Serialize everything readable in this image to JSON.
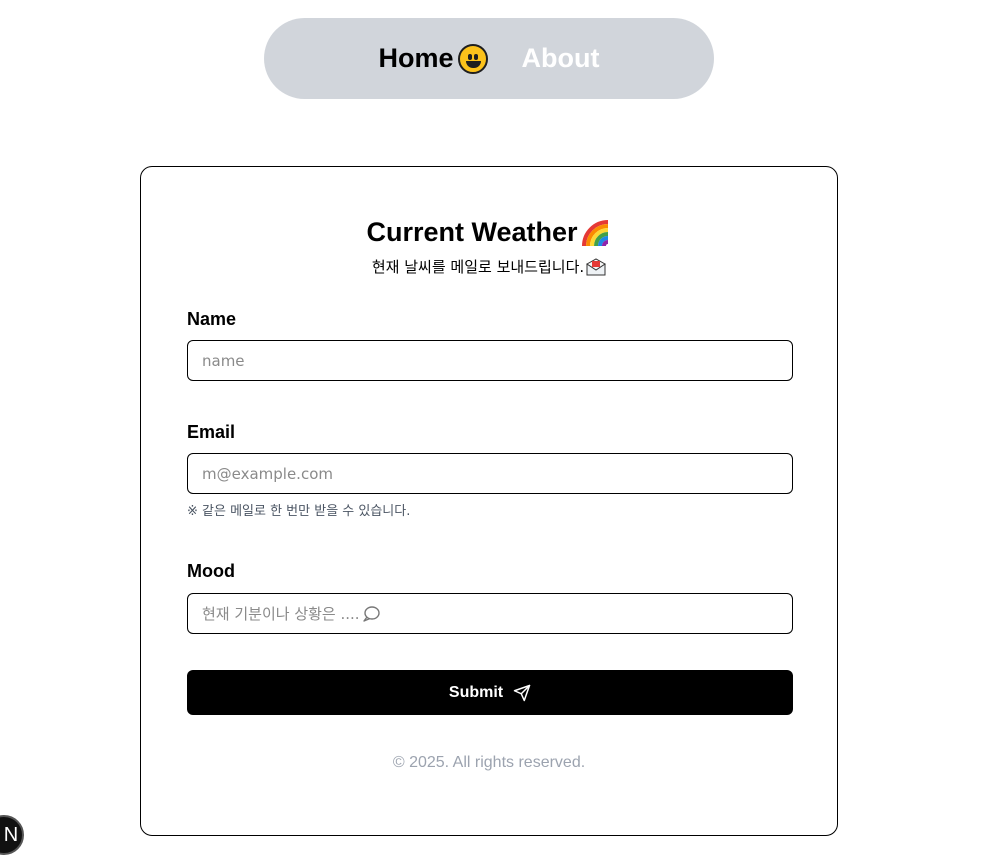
{
  "nav": {
    "home_label": "Home",
    "home_icon": "grinning-face-icon",
    "about_label": "About"
  },
  "card": {
    "title": "Current Weather",
    "title_icon": "rainbow-icon",
    "subtitle": "현재 날씨를 메일로 보내드립니다.",
    "subtitle_icon": "envelope-icon"
  },
  "form": {
    "name": {
      "label": "Name",
      "placeholder": "name",
      "value": ""
    },
    "email": {
      "label": "Email",
      "placeholder": "m@example.com",
      "value": "",
      "hint": "※ 같은 메일로 한 번만 받을 수 있습니다."
    },
    "mood": {
      "label": "Mood",
      "placeholder": "현재 기분이나 상황은 ....",
      "icon": "speech-bubble-icon"
    },
    "submit_label": "Submit",
    "submit_icon": "send-icon"
  },
  "footer": {
    "text": "© 2025. All rights reserved."
  },
  "dev_badge": {
    "label": "N"
  },
  "colors": {
    "nav_bg": "#d1d5db",
    "button_bg": "#000000",
    "hint_text": "#4b5563",
    "footer_text": "#9ca3af"
  }
}
